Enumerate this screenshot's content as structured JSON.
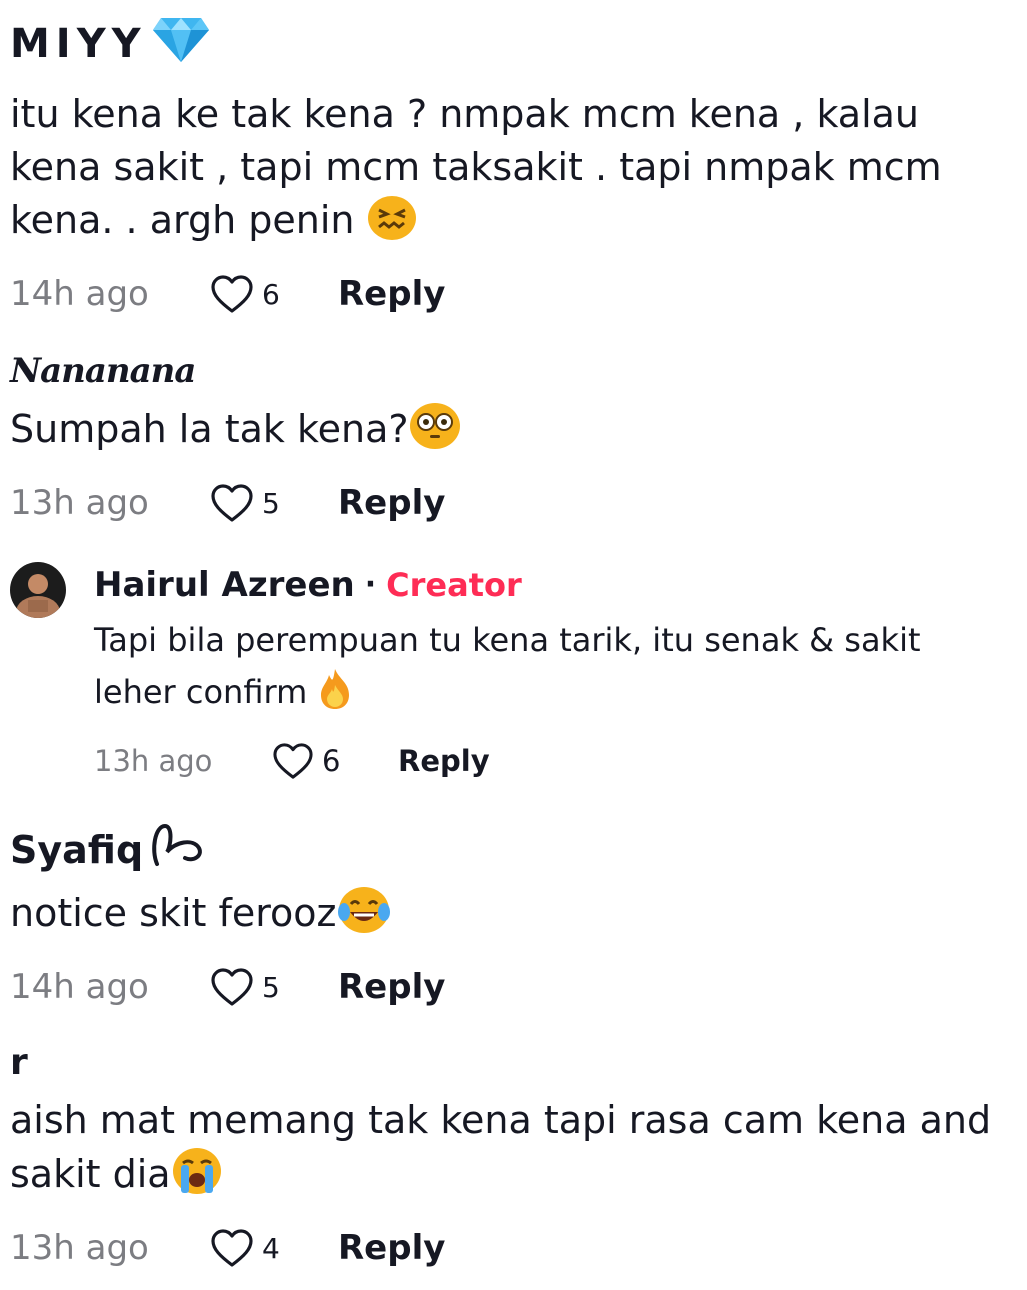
{
  "comments": [
    {
      "username": "MIYY",
      "badge_icon": "diamond-icon",
      "text": "itu kena ke tak kena ? nmpak mcm kena , kalau kena sakit , tapi mcm taksakit . tapi nmpak mcm kena. . argh penin",
      "emoji": "confounded-face-icon",
      "time": "14h ago",
      "likes": "6",
      "reply_label": "Reply"
    },
    {
      "username": "Nananana",
      "text": "Sumpah la tak kena?",
      "emoji": "flushed-face-icon",
      "time": "13h ago",
      "likes": "5",
      "reply_label": "Reply"
    },
    {
      "username": "Syafiq",
      "badge_icon": "smile-doodle-icon",
      "text": "notice skit ferooz",
      "emoji": "tears-of-joy-icon",
      "time": "14h ago",
      "likes": "5",
      "reply_label": "Reply"
    },
    {
      "username": "r",
      "text": "aish mat memang tak kena tapi rasa cam kena and sakit dia",
      "emoji": "loudly-crying-face-icon",
      "time": "13h ago",
      "likes": "4",
      "reply_label": "Reply"
    }
  ],
  "creator_reply": {
    "username": "Hairul Azreen",
    "separator": "·",
    "creator_label": "Creator",
    "text": "Tapi bila perempuan tu kena tarik, itu senak & sakit leher confirm",
    "emoji": "fire-icon",
    "time": "13h ago",
    "likes": "6",
    "reply_label": "Reply"
  },
  "colors": {
    "creator": "#fe2c55",
    "muted": "#7c7d82",
    "text": "#161823"
  }
}
